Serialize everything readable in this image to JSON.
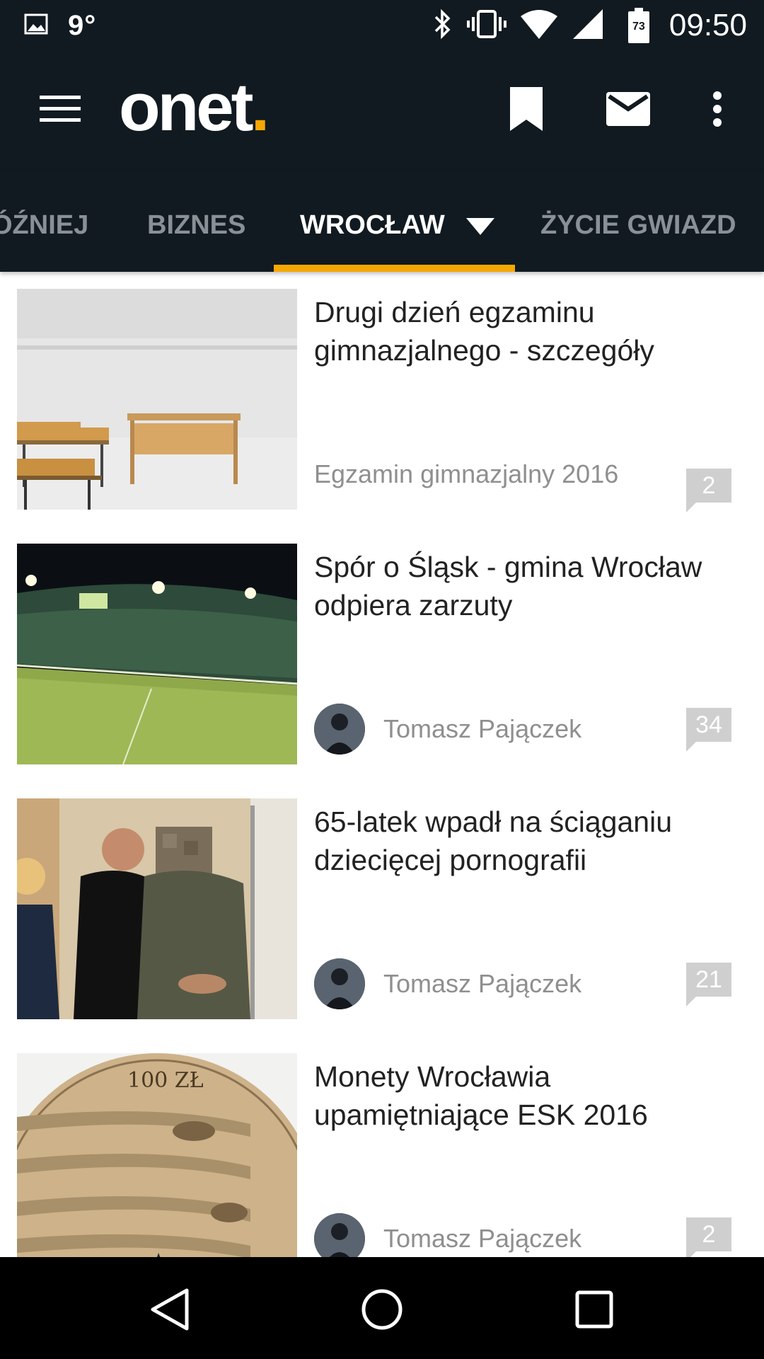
{
  "status_bar": {
    "temperature": "9°",
    "battery_level": "73",
    "time": "09:50",
    "icons": [
      "image-icon",
      "bluetooth-icon",
      "vibrate-icon",
      "wifi-icon",
      "signal-icon",
      "battery-icon"
    ]
  },
  "app_bar": {
    "logo_text": "onet",
    "logo_dot": ".",
    "actions": [
      "menu-icon",
      "bookmark-icon",
      "mail-icon",
      "more-vert-icon"
    ]
  },
  "tabs": [
    {
      "label": "ÓŹNIEJ"
    },
    {
      "label": "BIZNES"
    },
    {
      "label": "WROCŁAW",
      "active": true
    },
    {
      "label": "ŻYCIE GWIAZD"
    }
  ],
  "articles": [
    {
      "headline": "Drugi dzień egzaminu gimnazjalnego - szczegóły",
      "meta": "Egzamin gimnazjalny 2016",
      "comments": "2",
      "thumbnail": "classroom-desks"
    },
    {
      "headline": "Spór o Śląsk - gmina Wrocław odpiera zarzuty",
      "meta": "Tomasz Pajączek",
      "comments": "34",
      "thumbnail": "football-stadium"
    },
    {
      "headline": "65-latek wpadł na ściąganiu dziecięcej pornografii",
      "meta": "Tomasz Pajączek",
      "comments": "21",
      "thumbnail": "police-arrest"
    },
    {
      "headline": "Monety Wrocławia upamiętniające ESK 2016",
      "meta": "Tomasz Pajączek",
      "comments": "2",
      "thumbnail": "gold-coin",
      "coin_text": "100 ZŁ"
    }
  ],
  "colors": {
    "bar_background": "#111a21",
    "accent": "#f6a800",
    "tab_inactive": "#8a9096",
    "meta_text": "#8f8f8f",
    "comment_badge": "#cfcfcf"
  },
  "nav_bar": [
    "back-icon",
    "home-icon",
    "recents-icon"
  ]
}
